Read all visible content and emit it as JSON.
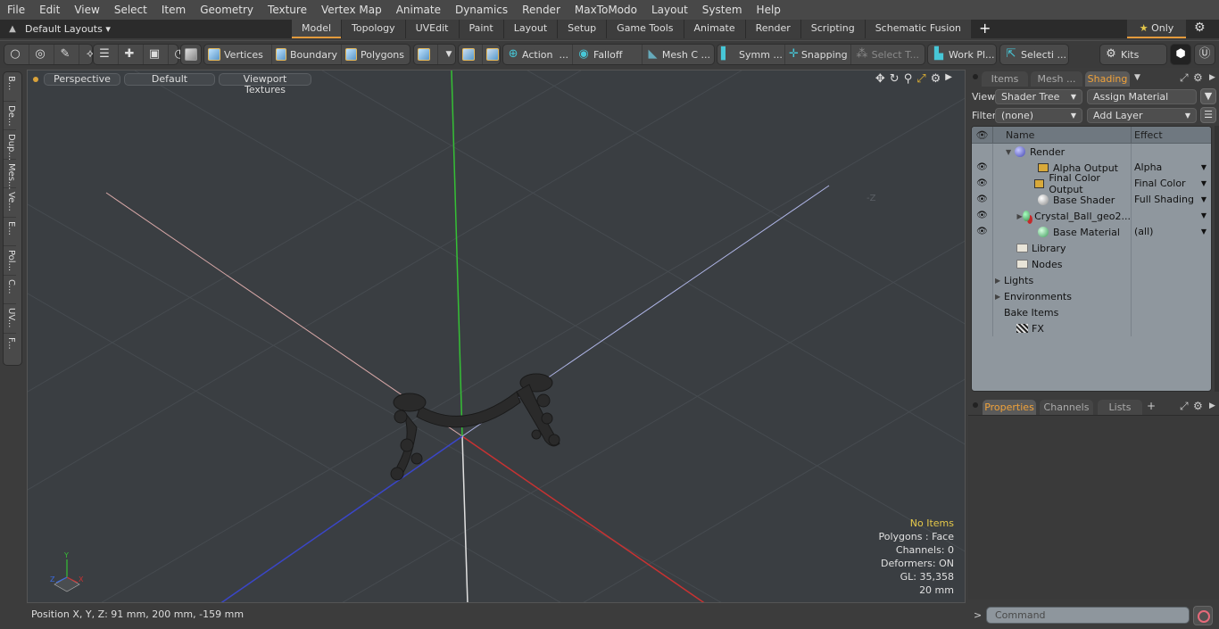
{
  "menu": [
    "File",
    "Edit",
    "View",
    "Select",
    "Item",
    "Geometry",
    "Texture",
    "Vertex Map",
    "Animate",
    "Dynamics",
    "Render",
    "MaxToModo",
    "Layout",
    "System",
    "Help"
  ],
  "layoutbar": {
    "layouts_label": "Default Layouts",
    "tabs": [
      "Model",
      "Topology",
      "UVEdit",
      "Paint",
      "Layout",
      "Setup",
      "Game Tools",
      "Animate",
      "Render",
      "Scripting",
      "Schematic Fusion"
    ],
    "active_tab": "Model",
    "add_tab": "+",
    "only_label": "Only"
  },
  "toolbar": {
    "modes": [
      "Vertices",
      "Boundary",
      "Polygons"
    ],
    "action": "Action",
    "falloff": "Falloff",
    "mesh": "Mesh C ...",
    "symm": "Symm ...",
    "snapping": "Snapping",
    "select_t": "Select T...",
    "workplane": "Work Pl...",
    "selection": "Selecti ...",
    "kits": "Kits",
    "ellipsis": "..."
  },
  "sidetabs": [
    "B...",
    "De...",
    "Dup...",
    "Mes...",
    "Ve...",
    "E...",
    "Pol...",
    "C...",
    "UV...",
    "F..."
  ],
  "viewport": {
    "buttons": [
      "Perspective",
      "Default",
      "Viewport Textures"
    ],
    "axis_label": "-Z",
    "info": {
      "items": "No Items",
      "polygons": "Polygons : Face",
      "channels": "Channels: 0",
      "deformers": "Deformers: ON",
      "gl": "GL: 35,358",
      "scale": "20 mm"
    },
    "gizmo": {
      "x": "X",
      "y": "Y",
      "z": "Z"
    }
  },
  "right_panel": {
    "tabs": [
      "Items",
      "Mesh ...",
      "Shading"
    ],
    "active_tab": "Shading",
    "view_label": "View",
    "view_value": "Shader Tree",
    "assign_material": "Assign Material",
    "filter_label": "Filter",
    "filter_value": "(none)",
    "add_layer": "Add Layer",
    "columns": {
      "name": "Name",
      "effect": "Effect"
    },
    "rows": [
      {
        "name": "Render",
        "effect": "",
        "icon": "sphere-blue",
        "eye": false,
        "expand": "down"
      },
      {
        "name": "Alpha Output",
        "effect": "Alpha",
        "icon": "image",
        "eye": true
      },
      {
        "name": "Final Color Output",
        "effect": "Final Color",
        "icon": "image",
        "eye": true
      },
      {
        "name": "Base Shader",
        "effect": "Full Shading",
        "icon": "sphere-white",
        "eye": true
      },
      {
        "name": "Crystal_Ball_geo2...",
        "effect": "",
        "icon": "sphere-material",
        "eye": true,
        "expand": "right"
      },
      {
        "name": "Base Material",
        "effect": "(all)",
        "icon": "sphere-green",
        "eye": true
      },
      {
        "name": "Library",
        "icon": "folder"
      },
      {
        "name": "Nodes",
        "icon": "folder"
      },
      {
        "name": "Lights",
        "expand": "right"
      },
      {
        "name": "Environments",
        "expand": "right"
      },
      {
        "name": "Bake Items"
      },
      {
        "name": "FX",
        "icon": "clapper"
      }
    ]
  },
  "bottom_panel": {
    "tabs": [
      "Properties",
      "Channels",
      "Lists"
    ],
    "active_tab": "Properties",
    "add": "+"
  },
  "status": {
    "position": "Position X, Y, Z:   91 mm, 200 mm, -159 mm"
  },
  "command": {
    "prompt": ">",
    "placeholder": "Command"
  },
  "colors": {
    "accent": "#e39a3c",
    "x_axis": "#c83232",
    "y_axis": "#35c035",
    "z_axis": "#3a46c8"
  }
}
